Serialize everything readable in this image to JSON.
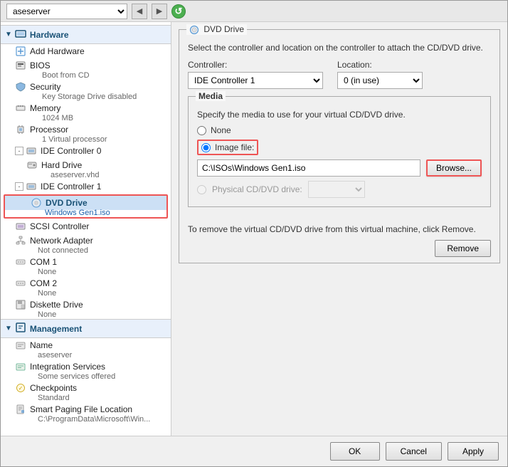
{
  "titleBar": {
    "serverName": "aseserver",
    "navBack": "◀",
    "navForward": "▶",
    "refresh": "↺"
  },
  "sidebar": {
    "sections": [
      {
        "name": "Hardware",
        "items": [
          {
            "id": "add-hardware",
            "label": "Add Hardware",
            "indent": 1,
            "icon": "add"
          },
          {
            "id": "bios",
            "label": "BIOS",
            "indent": 1,
            "icon": "bios",
            "sublabel": "Boot from CD"
          },
          {
            "id": "security",
            "label": "Security",
            "indent": 1,
            "icon": "security",
            "sublabel": "Key Storage Drive disabled"
          },
          {
            "id": "memory",
            "label": "Memory",
            "indent": 1,
            "icon": "memory",
            "sublabel": "1024 MB"
          },
          {
            "id": "processor",
            "label": "Processor",
            "indent": 1,
            "icon": "processor",
            "sublabel": "1 Virtual processor"
          },
          {
            "id": "ide-controller-0",
            "label": "IDE Controller 0",
            "indent": 1,
            "icon": "ide",
            "expandable": true,
            "expanded": true
          },
          {
            "id": "hard-drive",
            "label": "Hard Drive",
            "indent": 2,
            "icon": "harddrive",
            "sublabel": "aseserver.vhd"
          },
          {
            "id": "ide-controller-1",
            "label": "IDE Controller 1",
            "indent": 1,
            "icon": "ide",
            "expandable": true,
            "expanded": true
          },
          {
            "id": "dvd-drive",
            "label": "DVD Drive",
            "indent": 2,
            "icon": "dvd",
            "sublabel": "Windows Gen1.iso",
            "selected": true,
            "highlighted": true
          },
          {
            "id": "scsi-controller",
            "label": "SCSI Controller",
            "indent": 1,
            "icon": "scsi"
          },
          {
            "id": "network-adapter",
            "label": "Network Adapter",
            "indent": 1,
            "icon": "network",
            "sublabel": "Not connected"
          },
          {
            "id": "com1",
            "label": "COM 1",
            "indent": 1,
            "icon": "com",
            "sublabel": "None"
          },
          {
            "id": "com2",
            "label": "COM 2",
            "indent": 1,
            "icon": "com",
            "sublabel": "None"
          },
          {
            "id": "diskette-drive",
            "label": "Diskette Drive",
            "indent": 1,
            "icon": "diskette",
            "sublabel": "None"
          }
        ]
      },
      {
        "name": "Management",
        "items": [
          {
            "id": "name",
            "label": "Name",
            "indent": 1,
            "icon": "name",
            "sublabel": "aseserver"
          },
          {
            "id": "integration-services",
            "label": "Integration Services",
            "indent": 1,
            "icon": "integration",
            "sublabel": "Some services offered"
          },
          {
            "id": "checkpoints",
            "label": "Checkpoints",
            "indent": 1,
            "icon": "checkpoints",
            "sublabel": "Standard"
          },
          {
            "id": "smart-paging",
            "label": "Smart Paging File Location",
            "indent": 1,
            "icon": "paging",
            "sublabel": "C:\\ProgramData\\Microsoft\\Win..."
          }
        ]
      }
    ]
  },
  "dvdPanel": {
    "title": "DVD Drive",
    "description": "Select the controller and location on the controller to attach the CD/DVD drive.",
    "controllerLabel": "Controller:",
    "controllerValue": "IDE Controller 1",
    "locationLabel": "Location:",
    "locationValue": "0 (in use)",
    "mediaGroupLabel": "Media",
    "mediaDescription": "Specify the media to use for your virtual CD/DVD drive.",
    "noneLabel": "None",
    "imageFileLabel": "Image file:",
    "imageFileValue": "C:\\ISOs\\Windows Gen1.iso",
    "browseLabel": "Browse...",
    "physicalLabel": "Physical CD/DVD drive:",
    "removeText": "To remove the virtual CD/DVD drive from this virtual machine, click Remove.",
    "removeLabel": "Remove"
  },
  "bottomBar": {
    "okLabel": "OK",
    "cancelLabel": "Cancel",
    "applyLabel": "Apply"
  }
}
